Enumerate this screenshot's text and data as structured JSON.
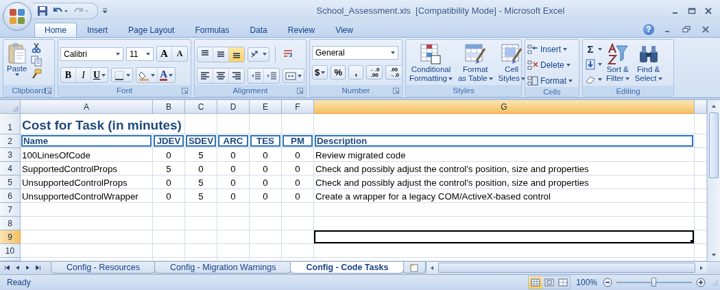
{
  "window": {
    "title": "School_Assessment.xls  [Compatibility Mode] - Microsoft Excel"
  },
  "ribbon_tabs": [
    {
      "label": "Home",
      "selected": true
    },
    {
      "label": "Insert",
      "selected": false
    },
    {
      "label": "Page Layout",
      "selected": false
    },
    {
      "label": "Formulas",
      "selected": false
    },
    {
      "label": "Data",
      "selected": false
    },
    {
      "label": "Review",
      "selected": false
    },
    {
      "label": "View",
      "selected": false
    }
  ],
  "help": "?",
  "ribbon_groups": [
    {
      "kind": "clipboard",
      "label": "Clipboard",
      "launcher": true,
      "paste": "Paste"
    },
    {
      "kind": "font",
      "label": "Font",
      "launcher": true,
      "font_name": "Calibri",
      "font_size": "11",
      "grow_font": "A",
      "shrink_font": "A",
      "bold": "B",
      "italic": "I",
      "underline": "U",
      "font_color": "A"
    },
    {
      "kind": "alignment",
      "label": "Alignment",
      "launcher": true,
      "vertical_align": [
        {
          "kind": "top",
          "selected": false
        },
        {
          "kind": "middle",
          "selected": false
        },
        {
          "kind": "bottom",
          "selected": true
        }
      ]
    },
    {
      "kind": "number",
      "label": "Number",
      "launcher": true,
      "format": "General",
      "buttons": [
        {
          "kind": "currency",
          "lines": [
            "$"
          ]
        },
        {
          "kind": "percent",
          "lines": [
            "%"
          ]
        },
        {
          "kind": "comma",
          "lines": [
            ","
          ]
        },
        {
          "kind": "increase-decimal",
          "lines": [
            "←.0",
            ".00"
          ]
        },
        {
          "kind": "decrease-decimal",
          "lines": [
            ".00",
            "→.0"
          ]
        }
      ]
    },
    {
      "kind": "styles",
      "label": "Styles",
      "launcher": false,
      "buttons": [
        {
          "kind": "conditional",
          "lines": [
            "Conditional",
            "Formatting"
          ]
        },
        {
          "kind": "table",
          "lines": [
            "Format",
            "as Table"
          ]
        },
        {
          "kind": "cell-styles",
          "lines": [
            "Cell",
            "Styles"
          ]
        }
      ]
    },
    {
      "kind": "cells",
      "label": "Cells",
      "launcher": false,
      "buttons": [
        {
          "kind": "insert",
          "label": "Insert"
        },
        {
          "kind": "delete",
          "label": "Delete"
        },
        {
          "kind": "format",
          "label": "Format"
        }
      ]
    },
    {
      "kind": "editing",
      "label": "Editing",
      "launcher": false,
      "autosum": "Σ",
      "buttons": [
        {
          "kind": "sort",
          "lines": [
            "Sort &",
            "Filter"
          ]
        },
        {
          "kind": "find",
          "lines": [
            "Find &",
            "Select"
          ]
        }
      ]
    }
  ],
  "sheet": {
    "columns": [
      {
        "label": "A",
        "selected": false
      },
      {
        "label": "B",
        "selected": false
      },
      {
        "label": "C",
        "selected": false
      },
      {
        "label": "D",
        "selected": false
      },
      {
        "label": "E",
        "selected": false
      },
      {
        "label": "F",
        "selected": false
      },
      {
        "label": "G",
        "selected": true
      }
    ],
    "rows": [
      {
        "number": "1",
        "kind": "title",
        "selected": false,
        "cells": [
          "Cost for Task (in minutes)"
        ]
      },
      {
        "number": "2",
        "kind": "header",
        "selected": false,
        "cells": [
          "Name",
          "JDEV",
          "SDEV",
          "ARC",
          "TES",
          "PM",
          "Description"
        ]
      },
      {
        "number": "3",
        "kind": "data",
        "selected": false,
        "cells": [
          "100LinesOfCode",
          "0",
          "5",
          "0",
          "0",
          "0",
          "Review migrated code"
        ]
      },
      {
        "number": "4",
        "kind": "data",
        "selected": false,
        "cells": [
          "SupportedControlProps",
          "5",
          "0",
          "0",
          "0",
          "0",
          "Check and possibly adjust the control's position, size and properties"
        ]
      },
      {
        "number": "5",
        "kind": "data",
        "selected": false,
        "cells": [
          "UnsupportedControlProps",
          "0",
          "5",
          "0",
          "0",
          "0",
          "Check and possibly adjust the control's position, size and properties"
        ]
      },
      {
        "number": "6",
        "kind": "data",
        "selected": false,
        "cells": [
          "UnsupportedControlWrapper",
          "0",
          "5",
          "0",
          "0",
          "0",
          "Create a wrapper for a legacy COM/ActiveX-based control"
        ]
      },
      {
        "number": "7",
        "kind": "empty",
        "selected": false
      },
      {
        "number": "8",
        "kind": "empty",
        "selected": false
      },
      {
        "number": "9",
        "kind": "empty",
        "selected": true
      },
      {
        "number": "10",
        "kind": "empty",
        "selected": false
      }
    ]
  },
  "sheet_tabs": [
    {
      "label": "Config - Resources",
      "selected": false
    },
    {
      "label": "Config - Migration Warnings",
      "selected": false
    },
    {
      "label": "Config - Code Tasks",
      "selected": true
    }
  ],
  "status_bar": {
    "status": "Ready",
    "views": [
      {
        "kind": "normal",
        "selected": true
      },
      {
        "kind": "page-layout",
        "selected": false
      },
      {
        "kind": "page-break",
        "selected": false
      }
    ],
    "zoom": "100%",
    "zoom_slider": {
      "level": 0.5
    }
  }
}
